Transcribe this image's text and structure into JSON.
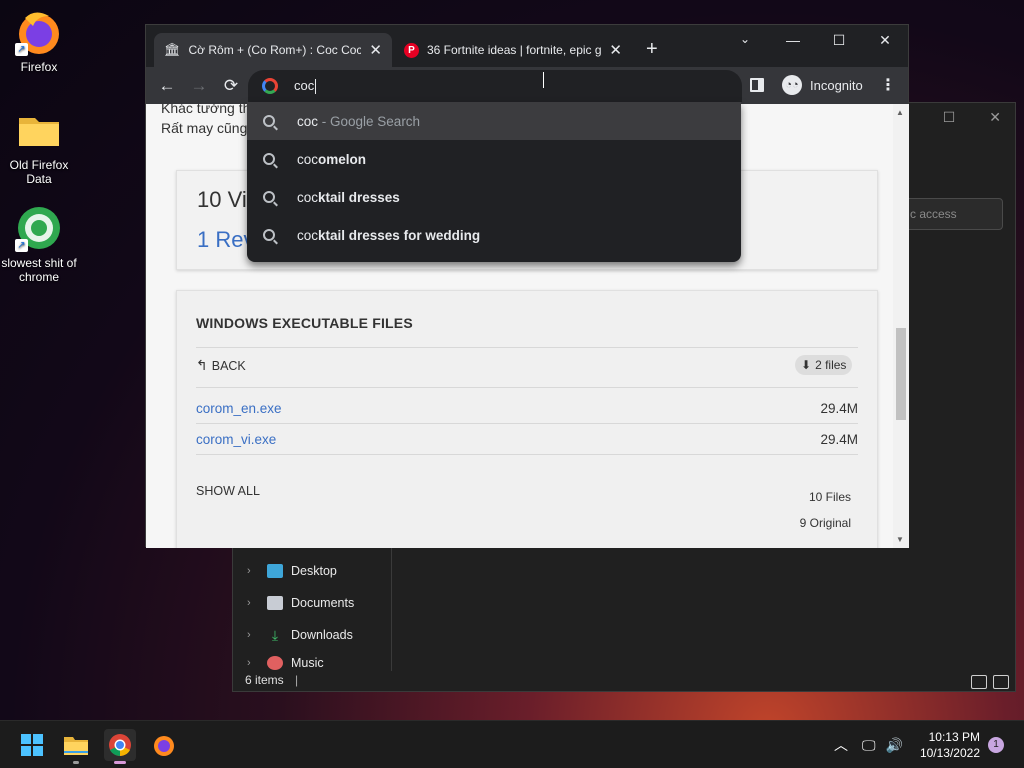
{
  "desktop": {
    "icons": [
      {
        "label": "Firefox",
        "icon": "firefox-icon"
      },
      {
        "label": "Old Firefox Data",
        "icon": "folder-icon"
      },
      {
        "label": "slowest shit of chrome",
        "icon": "chrome-shortcut-icon"
      }
    ]
  },
  "explorer": {
    "search_placeholder": "c access",
    "nav_items": [
      {
        "label": "Desktop",
        "color": "#3ea6d9"
      },
      {
        "label": "Documents",
        "color": "#c8ccd4"
      },
      {
        "label": "Downloads",
        "color": "#3fbf6a"
      },
      {
        "label": "Music",
        "color": "#e06060"
      }
    ],
    "status": "6 items"
  },
  "chrome": {
    "tabs": [
      {
        "title": "Cờ Rôm + (Co Rom+) : Coc Coc (",
        "icon": "bank-icon"
      },
      {
        "title": "36 Fortnite ideas | fortnite, epic g",
        "icon": "pinterest-icon"
      }
    ],
    "omnibox_text": "coc",
    "incognito_label": "Incognito",
    "suggestions": [
      {
        "typed": "coc",
        "rest": " - Google Search"
      },
      {
        "typed": "coc",
        "rest": "omelon"
      },
      {
        "typed": "coc",
        "rest": "ktail dresses"
      },
      {
        "typed": "coc",
        "rest": "ktail dresses for wedding"
      }
    ]
  },
  "page": {
    "top_line1": "Khác tưởng th",
    "top_line2": "Rất may cũng",
    "card1_line1": "10 Vi",
    "card1_line2": "1 Rev",
    "section_heading": "WINDOWS EXECUTABLE FILES",
    "back_label": "BACK",
    "files_badge": "2 files",
    "files": [
      {
        "name": "corom_en.exe",
        "size": "29.4M"
      },
      {
        "name": "corom_vi.exe",
        "size": "29.4M"
      }
    ],
    "show_all": "SHOW ALL",
    "count_files": "10 Files",
    "count_original": "9 Original"
  },
  "taskbar": {
    "time": "10:13 PM",
    "date": "10/13/2022",
    "notification_count": "1",
    "accent": "#4cc2ff"
  }
}
